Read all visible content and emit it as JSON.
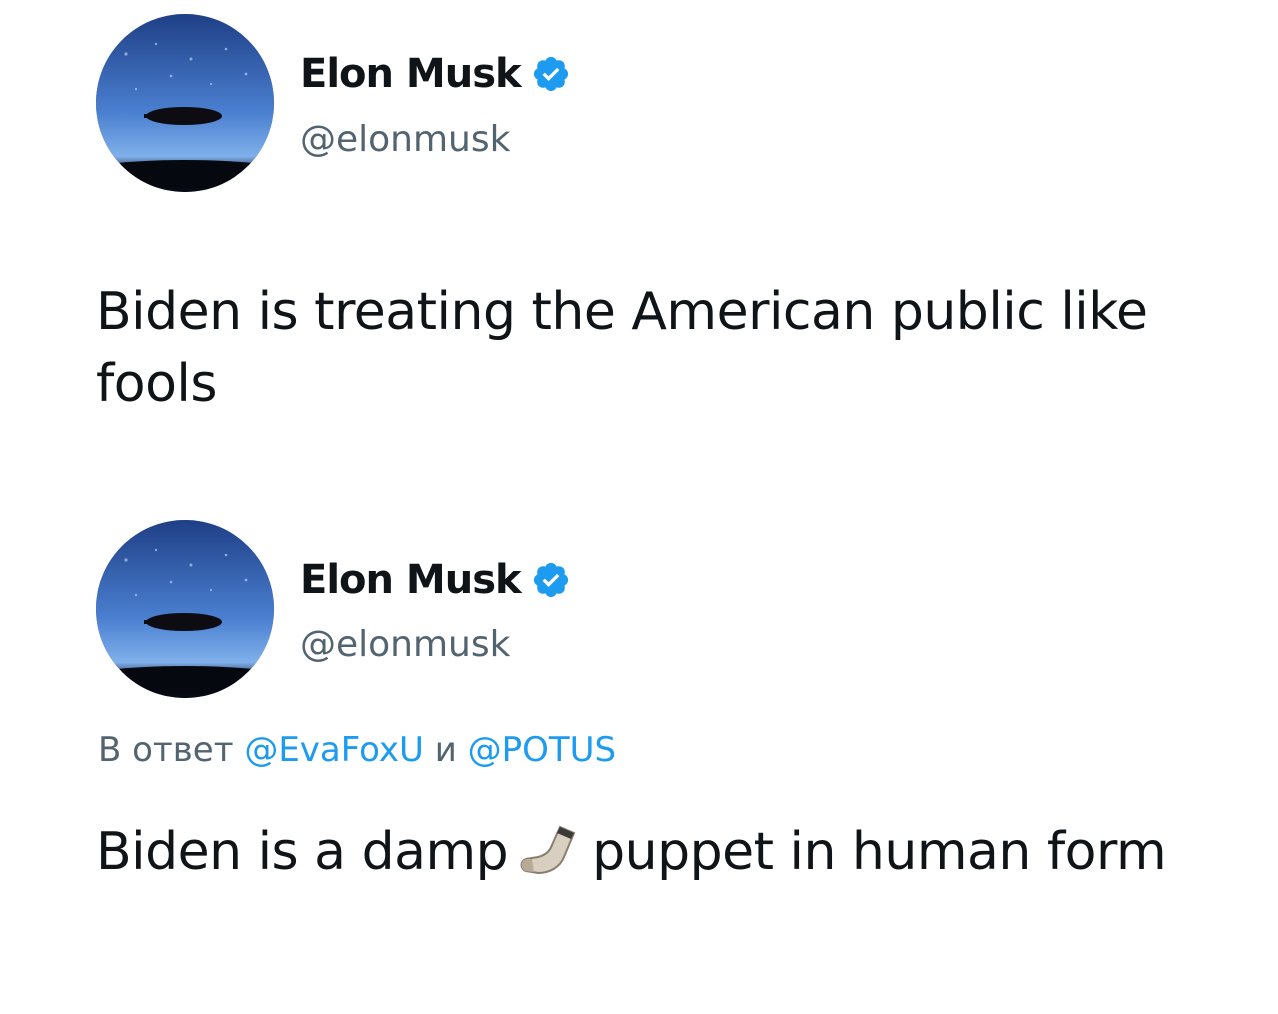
{
  "tweets": [
    {
      "author": {
        "name": "Elon Musk",
        "handle": "@elonmusk",
        "verified": true,
        "avatar": "space-image-avatar"
      },
      "text": "Biden is treating the American public like fools"
    },
    {
      "author": {
        "name": "Elon Musk",
        "handle": "@elonmusk",
        "verified": true,
        "avatar": "space-image-avatar"
      },
      "reply": {
        "prefix": "В ответ",
        "mention1": "@EvaFoxU",
        "conjunction": "и",
        "mention2": "@POTUS"
      },
      "text_before_emoji": "Biden is a damp",
      "emoji": "sock-icon",
      "text_after_emoji": "puppet in human form"
    }
  ],
  "colors": {
    "verified": "#1d9bf0",
    "mention": "#1d9bf0",
    "secondary_text": "#536471",
    "primary_text": "#0f1419"
  }
}
